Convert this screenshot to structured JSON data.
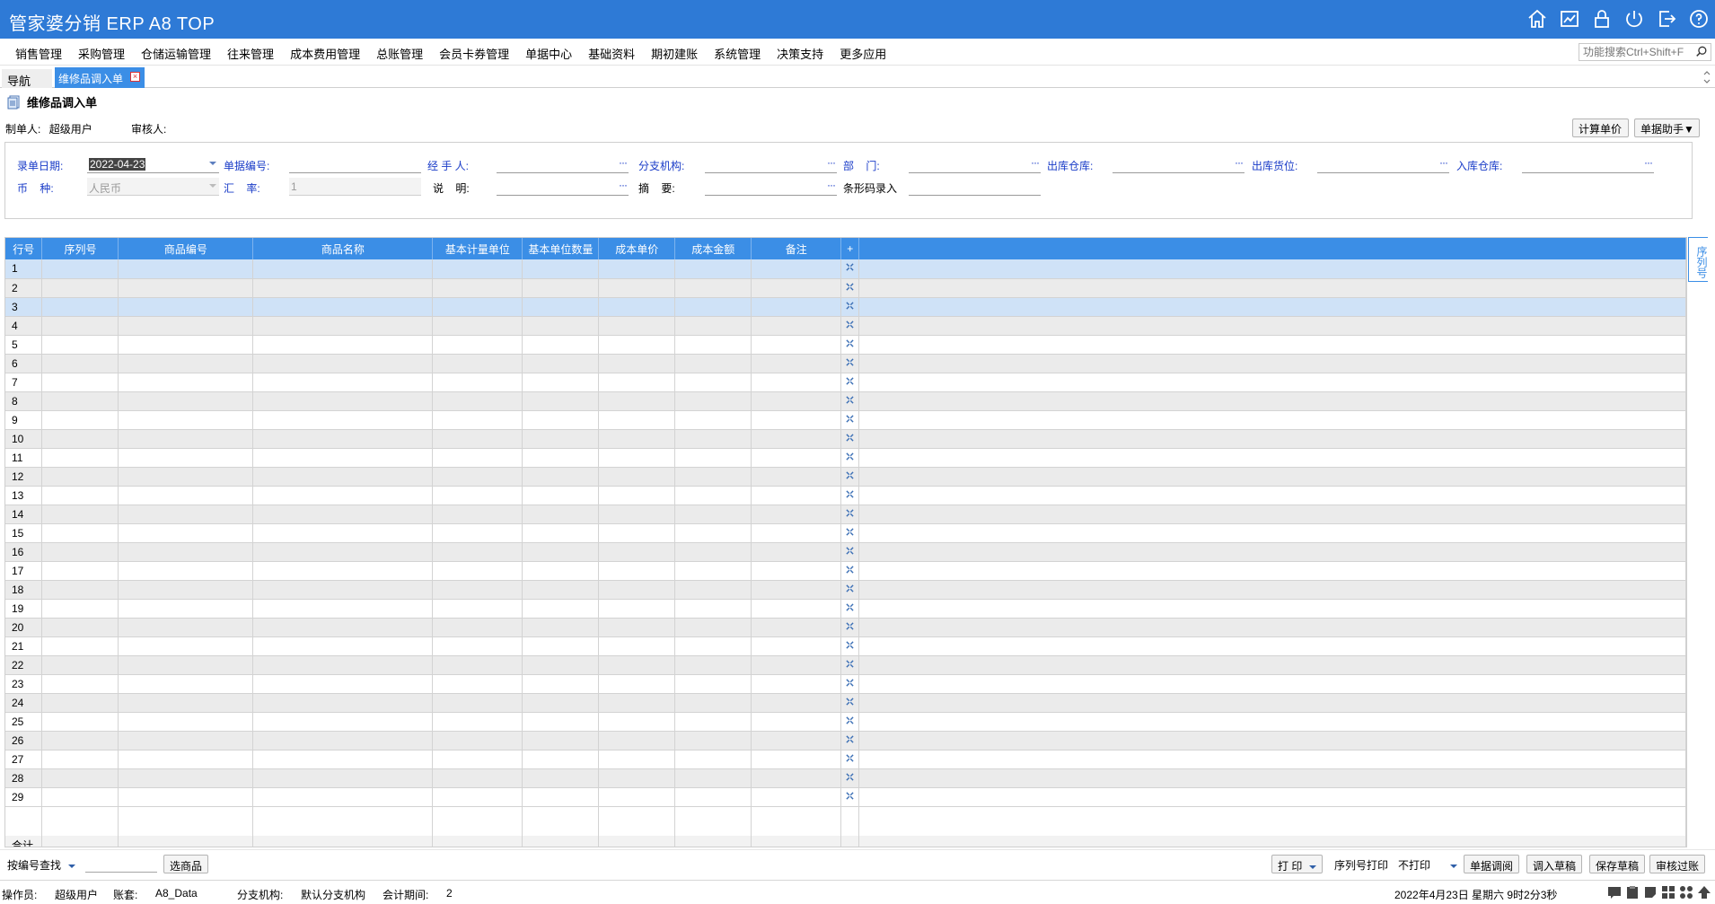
{
  "app": {
    "title": "管家婆分销 ERP A8 TOP",
    "brand_color": "#2e7ad6",
    "header_icons": [
      "home-icon",
      "chart-icon",
      "lock-icon",
      "power-icon",
      "exit-icon",
      "help-icon"
    ]
  },
  "menu": {
    "items": [
      "销售管理",
      "采购管理",
      "仓储运输管理",
      "往来管理",
      "成本费用管理",
      "总账管理",
      "会员卡券管理",
      "单据中心",
      "基础资料",
      "期初建账",
      "系统管理",
      "决策支持",
      "更多应用"
    ],
    "search_placeholder": "功能搜索Ctrl+Shift+F"
  },
  "tabs": {
    "nav_label": "导航",
    "active_label": "维修品调入单"
  },
  "doc": {
    "title": "维修品调入单",
    "creator_label": "制单人:",
    "creator_value": "超级用户",
    "auditor_label": "审核人:",
    "auditor_value": "",
    "calc_button": "计算单价",
    "helper_button": "单据助手▼"
  },
  "form": {
    "date_label": "录单日期:",
    "date_value": "2022-04-23",
    "docno_label": "单据编号:",
    "docno_value": "",
    "handler_label": "经 手 人:",
    "branch_label": "分支机构:",
    "dept_label": "部    门:",
    "out_wh_label": "出库仓库:",
    "out_loc_label": "出库货位:",
    "in_wh_label": "入库仓库:",
    "currency_label": "币    种:",
    "currency_value": "人民币",
    "rate_label": "汇    率:",
    "rate_value": "1",
    "note_label": "说    明:",
    "summary_label": "摘    要:",
    "barcode_label": "条形码录入",
    "lookup_dots": "···"
  },
  "grid": {
    "columns": [
      "行号",
      "序列号",
      "商品编号",
      "商品名称",
      "基本计量单位",
      "基本单位数量",
      "成本单价",
      "成本金额",
      "备注",
      "+"
    ],
    "row_count": 29,
    "selected_rows": [
      1,
      3
    ],
    "total_label": "合计",
    "side_tab": "序列号"
  },
  "bottom": {
    "lookup_mode": "按编号查找",
    "select_goods": "选商品",
    "print": "打 印",
    "serial_print_label": "序列号打印",
    "serial_print_value": "不打印",
    "btn_lookup": "单据调阅",
    "btn_load_draft": "调入草稿",
    "btn_save_draft": "保存草稿",
    "btn_audit": "审核过账"
  },
  "status": {
    "operator_label": "操作员:",
    "operator_value": "超级用户",
    "account_label": "账套:",
    "account_value": "A8_Data",
    "branch_label": "分支机构:",
    "branch_value": "默认分支机构",
    "period_label": "会计期间:",
    "period_value": "2",
    "datetime": "2022年4月23日 星期六 9时2分3秒"
  }
}
